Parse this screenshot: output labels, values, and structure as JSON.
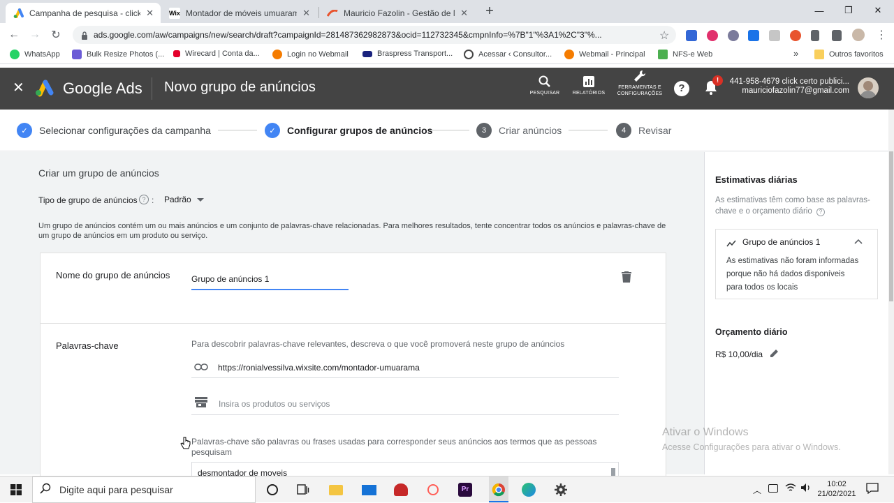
{
  "browser": {
    "tabs": [
      {
        "title": "Campanha de pesquisa - click ce",
        "favicon": "google-ads-icon",
        "active": true
      },
      {
        "title": "Montador de móveis umuarama",
        "favicon": "wix-icon",
        "active": false
      },
      {
        "title": "Mauricio Fazolin - Gestão de Ma",
        "favicon": "brand-icon",
        "active": false
      }
    ],
    "new_tab_label": "+",
    "url": "ads.google.com/aw/campaigns/new/search/draft?campaignId=281487362982873&ocid=112732345&cmpnInfo=%7B\"1\"%3A1%2C\"3\"%...",
    "bookmarks": [
      {
        "label": "WhatsApp",
        "color": "#25d366"
      },
      {
        "label": "Bulk Resize Photos (...",
        "color": "#6b5bd6"
      },
      {
        "label": "Wirecard | Conta da...",
        "color": "#e4002b"
      },
      {
        "label": "Login no Webmail",
        "color": "#f57c00"
      },
      {
        "label": "Braspress Transport...",
        "color": "#1a237e"
      },
      {
        "label": "Acessar ‹ Consultor...",
        "color": "#464646"
      },
      {
        "label": "Webmail - Principal",
        "color": "#f57c00"
      },
      {
        "label": "NFS-e Web",
        "color": "#4caf50"
      }
    ],
    "bookmarks_overflow": "»",
    "other_bookmarks": "Outros favoritos"
  },
  "ads_header": {
    "logo_text": "Google Ads",
    "page_title": "Novo grupo de anúncios",
    "tools": [
      {
        "label": "PESQUISAR",
        "icon": "search-icon"
      },
      {
        "label": "RELATÓRIOS",
        "icon": "reports-icon"
      },
      {
        "label": "FERRAMENTAS E CONFIGURAÇÕES",
        "icon": "wrench-icon"
      }
    ],
    "notification_count": "!",
    "account_line1": "441-958-4679 click certo publici...",
    "account_line2": "mauriciofazolin77@gmail.com"
  },
  "stepper": {
    "steps": [
      {
        "label": "Selecionar configurações da campanha",
        "num": "",
        "state": "done"
      },
      {
        "label": "Configurar grupos de anúncios",
        "num": "",
        "state": "current"
      },
      {
        "label": "Criar anúncios",
        "num": "3",
        "state": "todo"
      },
      {
        "label": "Revisar",
        "num": "4",
        "state": "todo"
      }
    ]
  },
  "form": {
    "section_title": "Criar um grupo de anúncios",
    "type_label": "Tipo de grupo de anúncios",
    "type_value": "Padrão",
    "description": "Um grupo de anúncios contém um ou mais anúncios e um conjunto de palavras-chave relacionadas. Para melhores resultados, tente concentrar todos os anúncios e palavras-chave de um grupo de anúncios em um produto ou serviço.",
    "name_label": "Nome do grupo de anúncios",
    "name_value": "Grupo de anúncios 1",
    "keywords_label": "Palavras-chave",
    "keywords_help": "Para descobrir palavras-chave relevantes, descreva o que você promoverá neste grupo de anúncios",
    "url_value": "https://ronialvessilva.wixsite.com/montador-umuarama",
    "products_placeholder": "Insira os produtos ou serviços",
    "keywords_desc": "Palavras-chave são palavras ou frases usadas para corresponder seus anúncios aos termos que as pessoas pesquisam",
    "keyword_entry": "desmontador de moveis"
  },
  "sidebar": {
    "title": "Estimativas diárias",
    "subtitle": "As estimativas têm como base as palavras-chave e o orçamento diário",
    "group_title": "Grupo de anúncios 1",
    "group_msg": "As estimativas não foram informadas porque não há dados disponíveis para todos os locais",
    "budget_title": "Orçamento diário",
    "budget_value": "R$ 10,00/dia"
  },
  "watermark": {
    "line1": "Ativar o Windows",
    "line2": "Acesse Configurações para ativar o Windows."
  },
  "taskbar": {
    "search_placeholder": "Digite aqui para pesquisar",
    "time": "10:02",
    "date": "21/02/2021"
  },
  "colors": {
    "ads_header_bg": "#444444",
    "accent_blue": "#4285f4",
    "notif_red": "#d93025"
  }
}
